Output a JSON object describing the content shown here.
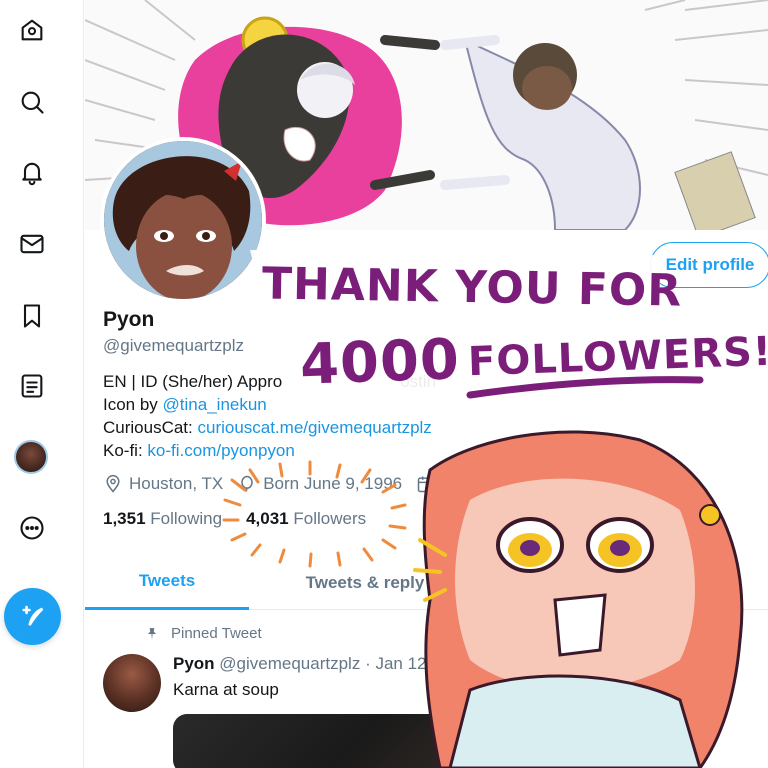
{
  "sidebar": {
    "icons": [
      "home-icon",
      "search-icon",
      "bell-icon",
      "mail-icon",
      "bookmark-icon",
      "list-icon",
      "profile-avatar",
      "more-icon"
    ],
    "compose_icon": "feather-plus-icon"
  },
  "profile": {
    "name": "Pyon",
    "handle": "@givemequartzplz",
    "bio_line1": "EN | ID (She/her) Appro",
    "bio_line1_tail": "ostin",
    "bio_line2_prefix": "Icon by ",
    "bio_line2_link": "@tina_inekun",
    "bio_line3_prefix": "CuriousCat: ",
    "bio_line3_link": "curiouscat.me/givemequartzplz",
    "bio_line4_prefix": "Ko-fi: ",
    "bio_line4_link": "ko-fi.com/pyonpyon",
    "location": "Houston, TX",
    "born": "Born June 9, 1996",
    "joined": "Join",
    "following_count": "1,351",
    "following_label": "Following",
    "followers_count": "4,031",
    "followers_label": "Followers",
    "edit_button": "Edit profile"
  },
  "tabs": [
    "Tweets",
    "Tweets & reply"
  ],
  "pinned": {
    "label": "Pinned Tweet",
    "author": "Pyon",
    "handle": "@givemequartzplz",
    "date": "· Jan 12",
    "text": "Karna at soup"
  },
  "overlay": {
    "line1": "THANK YOU FOR",
    "line2a": "4000",
    "line2b": "FOLLOWERS!"
  },
  "colors": {
    "accent": "#1da1f2",
    "link": "#1b95e0",
    "overlay_text": "#7b1e7a",
    "banner_pink": "#e8409c"
  }
}
